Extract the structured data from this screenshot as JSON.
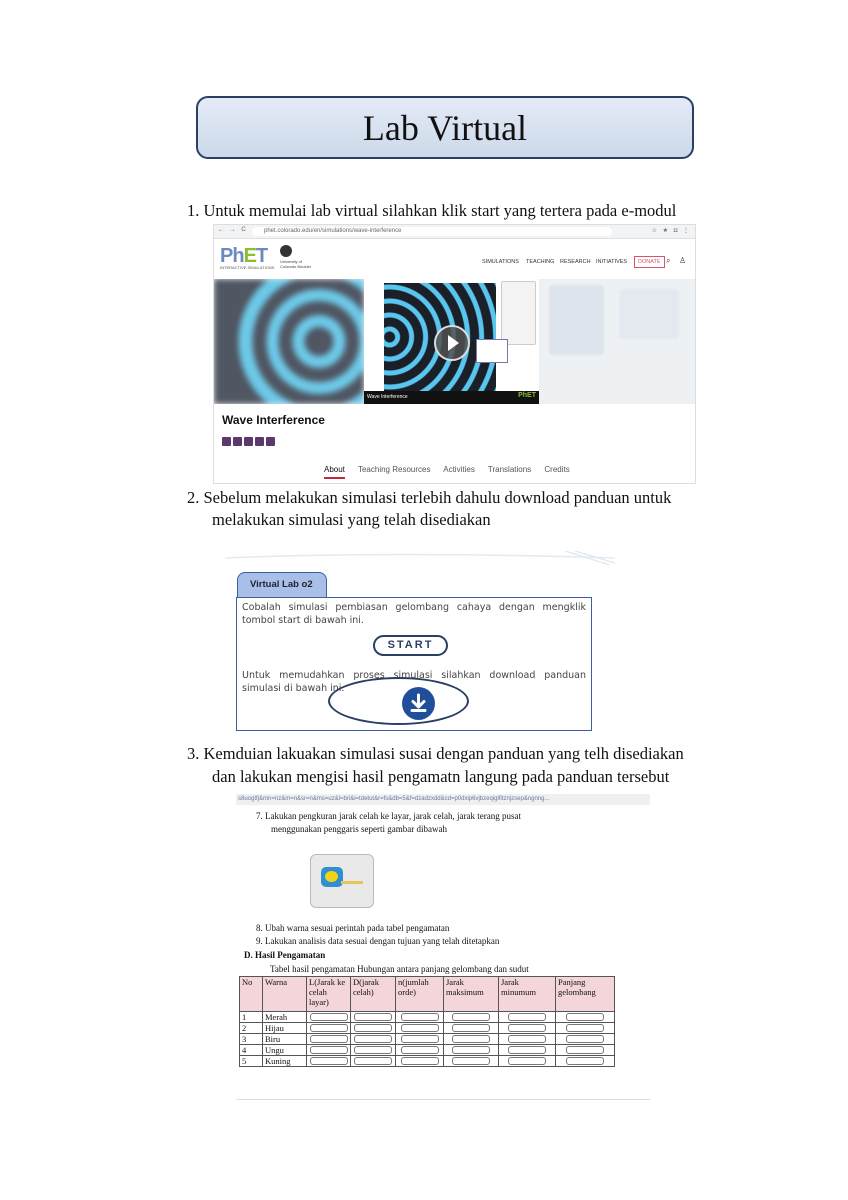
{
  "title": "Lab Virtual",
  "steps": [
    {
      "line1": "1. Untuk memulai  lab virtual silahkan  klik start yang tertera pada e-modul"
    },
    {
      "line1": "2. Sebelum melakukan simulasi  terlebih dahulu download panduan untuk",
      "line2": "melakukan simulasi  yang telah disediakan"
    },
    {
      "line1": "3. Kemduian lakuakan simulasi  susai dengan panduan yang telh disediakan",
      "line2": "dan lakukan mengisi hasil  pengamatn  langung pada panduan tersebut"
    }
  ],
  "phet": {
    "url": "phet.colorado.edu/en/simulations/wave-interference",
    "logo_main": "PhET",
    "logo_sub": "INTERACTIVE SIMULATIONS",
    "cu_text": "University of Colorado Boulder",
    "nav": [
      "SIMULATIONS",
      "TEACHING",
      "RESEARCH",
      "INITIATIVES"
    ],
    "donate": "DONATE",
    "sim_bar_label": "Wave Interference",
    "sim_title": "Wave Interference",
    "tabs": [
      "About",
      "Teaching Resources",
      "Activities",
      "Translations",
      "Credits"
    ]
  },
  "virtual_lab": {
    "tab_label": "Virtual Lab o2",
    "text1": "Cobalah simulasi pembiasan gelombang cahaya dengan mengklik tombol start di bawah ini.",
    "start_label": "START",
    "text2": "Untuk memudahkan proses simulasi silahkan download panduan simulasi di bawah ini."
  },
  "worksheet": {
    "url_fragment": "s8uogtfj&mn=nz&m=n&sr=n&ms=uz&l=bri&i=tdetut&r=fs&db=5&f=dzadzxdd&cd=p0dxip6vjbzeqiglfitznjzsep&ngnng...",
    "item7_line1": "7.   Lakukan pengkuran jarak celah ke layar, jarak celah, jarak terang pusat",
    "item7_line2": "menggunakan penggaris seperti gambar dibawah",
    "item8": "8.   Ubah warna sesuai perintah pada tabel pengamatan",
    "item9": "9.   Lakukan analisis data sesuai dengan tujuan yang telah ditetapkan",
    "section_heading": "D.  Hasil Pengamatan",
    "table_caption": "Tabel hasil pengamatan Hubungan antara panjang gelombang dan sudut",
    "table_headers": [
      "No",
      "Warna",
      "L(Jarak ke celah layar)",
      "D(jarak celah)",
      "n(jumlah orde)",
      "Jarak maksimum",
      "Jarak minumum",
      "Panjang gelombang"
    ],
    "rows": [
      {
        "no": "1",
        "warna": "Merah"
      },
      {
        "no": "2",
        "warna": "Hijau"
      },
      {
        "no": "3",
        "warna": "Biru"
      },
      {
        "no": "4",
        "warna": "Ungu"
      },
      {
        "no": "5",
        "warna": "Kuning"
      }
    ]
  }
}
